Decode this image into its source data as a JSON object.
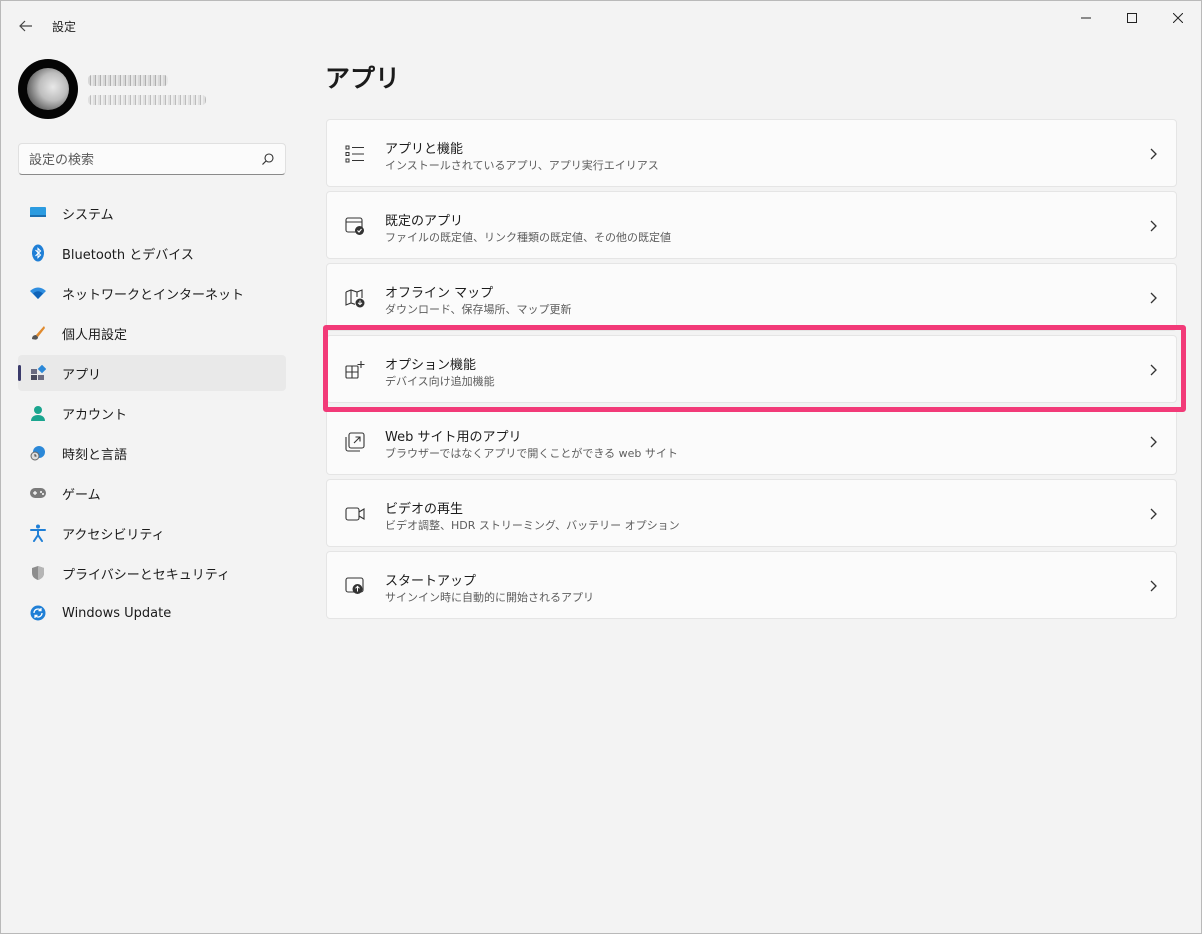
{
  "window": {
    "title": "設定"
  },
  "sidebar": {
    "search": {
      "placeholder": "設定の検索"
    },
    "items": [
      {
        "label": "システム",
        "icon": "monitor-icon"
      },
      {
        "label": "Bluetooth とデバイス",
        "icon": "bluetooth-icon"
      },
      {
        "label": "ネットワークとインターネット",
        "icon": "wifi-icon"
      },
      {
        "label": "個人用設定",
        "icon": "brush-icon"
      },
      {
        "label": "アプリ",
        "icon": "apps-icon",
        "active": true
      },
      {
        "label": "アカウント",
        "icon": "person-icon"
      },
      {
        "label": "時刻と言語",
        "icon": "globe-clock-icon"
      },
      {
        "label": "ゲーム",
        "icon": "gamepad-icon"
      },
      {
        "label": "アクセシビリティ",
        "icon": "accessibility-icon"
      },
      {
        "label": "プライバシーとセキュリティ",
        "icon": "shield-icon"
      },
      {
        "label": "Windows Update",
        "icon": "update-icon"
      }
    ]
  },
  "main": {
    "title": "アプリ",
    "cards": [
      {
        "title": "アプリと機能",
        "desc": "インストールされているアプリ、アプリ実行エイリアス",
        "icon": "list-icon"
      },
      {
        "title": "既定のアプリ",
        "desc": "ファイルの既定値、リンク種類の既定値、その他の既定値",
        "icon": "default-apps-icon"
      },
      {
        "title": "オフライン マップ",
        "desc": "ダウンロード、保存場所、マップ更新",
        "icon": "map-download-icon"
      },
      {
        "title": "オプション機能",
        "desc": "デバイス向け追加機能",
        "icon": "grid-add-icon",
        "highlighted": true
      },
      {
        "title": "Web サイト用のアプリ",
        "desc": "ブラウザーではなくアプリで開くことができる web サイト",
        "icon": "open-external-icon"
      },
      {
        "title": "ビデオの再生",
        "desc": "ビデオ調整、HDR ストリーミング、バッテリー オプション",
        "icon": "video-icon"
      },
      {
        "title": "スタートアップ",
        "desc": "サインイン時に自動的に開始されるアプリ",
        "icon": "startup-icon"
      }
    ]
  },
  "colors": {
    "highlight": "#f23a78",
    "accent": "#0067c0",
    "active_indicator": "#3b3b6b"
  }
}
